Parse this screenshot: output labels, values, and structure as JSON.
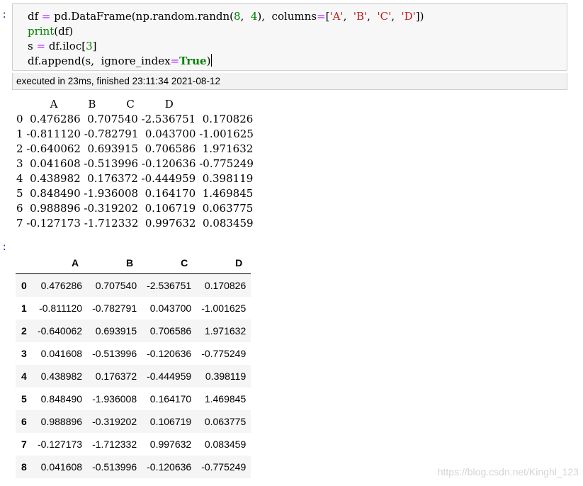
{
  "prompt_markers": [
    ":",
    ":"
  ],
  "code_lines": [
    [
      [
        "name",
        "df "
      ],
      [
        "op",
        "="
      ],
      [
        "name",
        " pd.DataFrame(np.random.randn("
      ],
      [
        "num",
        "8"
      ],
      [
        "name",
        ",  "
      ],
      [
        "num",
        "4"
      ],
      [
        "name",
        "),  columns"
      ],
      [
        "op",
        "="
      ],
      [
        "name",
        "["
      ],
      [
        "str",
        "'A'"
      ],
      [
        "name",
        ",  "
      ],
      [
        "str",
        "'B'"
      ],
      [
        "name",
        ",  "
      ],
      [
        "str",
        "'C'"
      ],
      [
        "name",
        ",  "
      ],
      [
        "str",
        "'D'"
      ],
      [
        "name",
        "])"
      ]
    ],
    [
      [
        "builtin",
        "print"
      ],
      [
        "name",
        "(df)"
      ]
    ],
    [
      [
        "name",
        "s "
      ],
      [
        "op",
        "="
      ],
      [
        "name",
        " df.iloc["
      ],
      [
        "num",
        "3"
      ],
      [
        "name",
        "]"
      ]
    ],
    [
      [
        "name",
        "df.append(s,  ignore_index"
      ],
      [
        "op",
        "="
      ],
      [
        "kw",
        "True"
      ],
      [
        "name",
        ")"
      ]
    ]
  ],
  "exec_status": "executed in 23ms, finished 23:11:34 2021-08-12",
  "stdout_lines": [
    "          A         B         C         D",
    "0  0.476286  0.707540 -2.536751  0.170826",
    "1 -0.811120 -0.782791  0.043700 -1.001625",
    "2 -0.640062  0.693915  0.706586  1.971632",
    "3  0.041608 -0.513996 -0.120636 -0.775249",
    "4  0.438982  0.176372 -0.444959  0.398119",
    "5  0.848490 -1.936008  0.164170  1.469845",
    "6  0.988896 -0.319202  0.106719  0.063775",
    "7 -0.127173 -1.712332  0.997632  0.083459"
  ],
  "table": {
    "columns": [
      "A",
      "B",
      "C",
      "D"
    ],
    "rows": [
      {
        "index": "0",
        "values": [
          "0.476286",
          "0.707540",
          "-2.536751",
          "0.170826"
        ]
      },
      {
        "index": "1",
        "values": [
          "-0.811120",
          "-0.782791",
          "0.043700",
          "-1.001625"
        ]
      },
      {
        "index": "2",
        "values": [
          "-0.640062",
          "0.693915",
          "0.706586",
          "1.971632"
        ]
      },
      {
        "index": "3",
        "values": [
          "0.041608",
          "-0.513996",
          "-0.120636",
          "-0.775249"
        ]
      },
      {
        "index": "4",
        "values": [
          "0.438982",
          "0.176372",
          "-0.444959",
          "0.398119"
        ]
      },
      {
        "index": "5",
        "values": [
          "0.848490",
          "-1.936008",
          "0.164170",
          "1.469845"
        ]
      },
      {
        "index": "6",
        "values": [
          "0.988896",
          "-0.319202",
          "0.106719",
          "0.063775"
        ]
      },
      {
        "index": "7",
        "values": [
          "-0.127173",
          "-1.712332",
          "0.997632",
          "0.083459"
        ]
      },
      {
        "index": "8",
        "values": [
          "0.041608",
          "-0.513996",
          "-0.120636",
          "-0.775249"
        ]
      }
    ]
  },
  "watermark": "https://blog.csdn.net/Kinghl_123",
  "colors": {
    "keyword": "#008000",
    "string": "#BA2121",
    "operator": "#AA22FF",
    "prompt": "#303F9F"
  }
}
